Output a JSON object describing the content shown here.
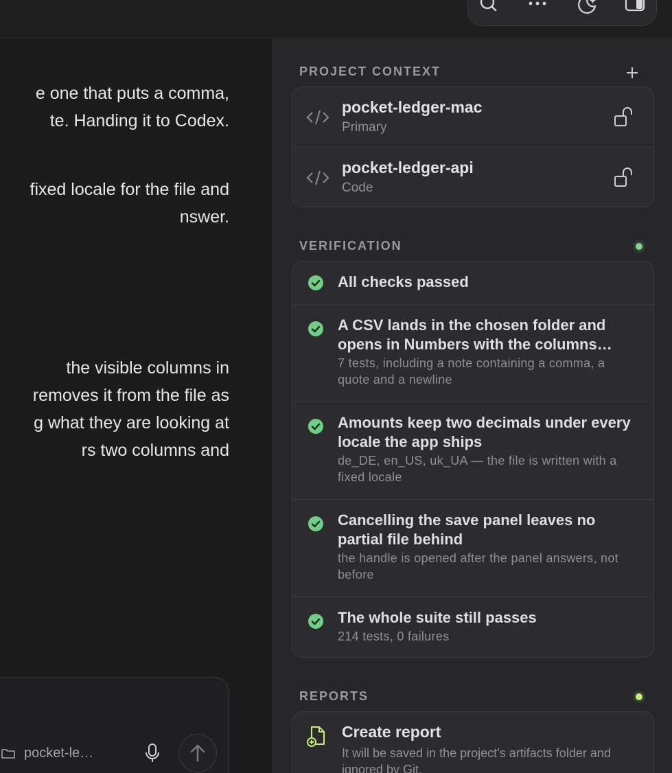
{
  "chat": {
    "lines": [
      "e one that puts a comma,",
      "te. Handing it to Codex.",
      "fixed locale for the file and",
      "nswer.",
      "the visible columns in",
      "removes it from the file as",
      "g what they are looking at",
      "rs two columns and"
    ],
    "composer": {
      "folder_label": "pocket-le…"
    }
  },
  "sidebar": {
    "project_context": {
      "title": "PROJECT CONTEXT",
      "items": [
        {
          "name": "pocket-ledger-mac",
          "sub": "Primary"
        },
        {
          "name": "pocket-ledger-api",
          "sub": "Code"
        }
      ]
    },
    "verification": {
      "title": "VERIFICATION",
      "items": [
        {
          "title": "All checks passed",
          "sub": ""
        },
        {
          "title": "A CSV lands in the chosen folder and opens in Numbers with the columns…",
          "sub": "7 tests, including a note containing a comma, a quote and a newline"
        },
        {
          "title": "Amounts keep two decimals under every locale the app ships",
          "sub": "de_DE, en_US, uk_UA — the file is written with a fixed locale"
        },
        {
          "title": "Cancelling the save panel leaves no partial file behind",
          "sub": "the handle is opened after the panel answers, not before"
        },
        {
          "title": "The whole suite still passes",
          "sub": "214 tests, 0 failures"
        }
      ]
    },
    "reports": {
      "title": "REPORTS",
      "create_title": "Create report",
      "create_sub": "It will be saved in the project’s artifacts folder and ignored by Git."
    }
  },
  "colors": {
    "accent_green": "#6fcf86",
    "status_lime": "#c6ef7a"
  },
  "icons": [
    "search-icon",
    "more-icon",
    "night-mode-icon",
    "sidebar-toggle-icon",
    "add-icon",
    "code-icon",
    "unlock-icon",
    "check-icon",
    "report-icon",
    "folder-icon",
    "mic-icon",
    "send-icon"
  ]
}
